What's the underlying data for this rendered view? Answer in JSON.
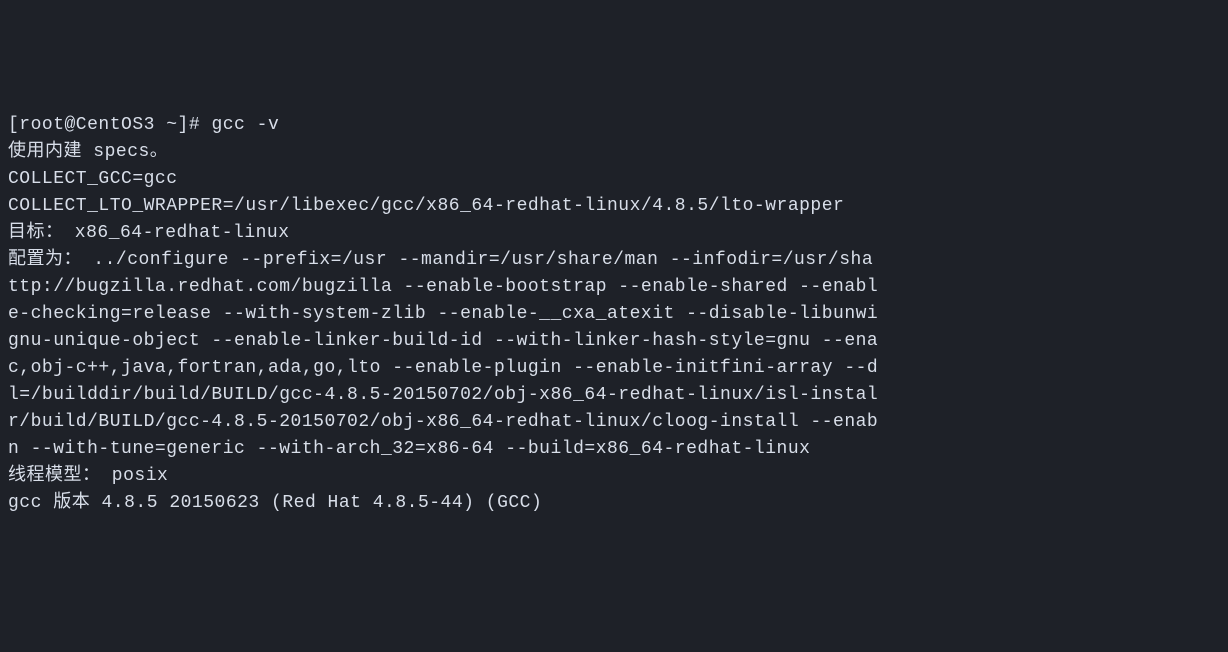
{
  "terminal": {
    "prompt": "[root@CentOS3 ~]# ",
    "command": "gcc -v",
    "lines": [
      "使用内建 specs。",
      "COLLECT_GCC=gcc",
      "COLLECT_LTO_WRAPPER=/usr/libexec/gcc/x86_64-redhat-linux/4.8.5/lto-wrapper",
      "目标： x86_64-redhat-linux",
      "配置为： ../configure --prefix=/usr --mandir=/usr/share/man --infodir=/usr/sha",
      "ttp://bugzilla.redhat.com/bugzilla --enable-bootstrap --enable-shared --enabl",
      "e-checking=release --with-system-zlib --enable-__cxa_atexit --disable-libunwi",
      "gnu-unique-object --enable-linker-build-id --with-linker-hash-style=gnu --ena",
      "c,obj-c++,java,fortran,ada,go,lto --enable-plugin --enable-initfini-array --d",
      "l=/builddir/build/BUILD/gcc-4.8.5-20150702/obj-x86_64-redhat-linux/isl-instal",
      "r/build/BUILD/gcc-4.8.5-20150702/obj-x86_64-redhat-linux/cloog-install --enab",
      "n --with-tune=generic --with-arch_32=x86-64 --build=x86_64-redhat-linux",
      "线程模型： posix",
      "gcc 版本 4.8.5 20150623 (Red Hat 4.8.5-44) (GCC) "
    ]
  }
}
